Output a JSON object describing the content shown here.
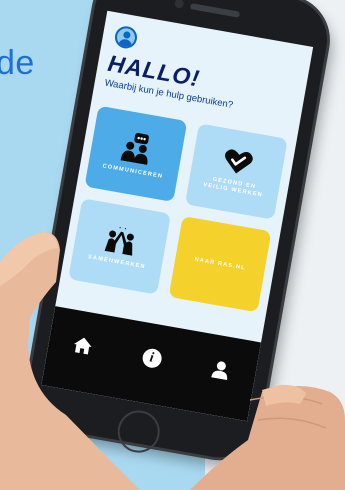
{
  "background": {
    "headline_fragment": "de"
  },
  "app": {
    "greeting": "HALLO!",
    "subtitle": "Waarbij kun je hulp gebruiken?",
    "tiles": [
      {
        "label": "COMMUNICEREN",
        "icon": "chat-people-icon",
        "color": "#4dabe8"
      },
      {
        "label": "GEZOND EN VEILIG WERKEN",
        "icon": "heart-check-icon",
        "color": "#aedbf6"
      },
      {
        "label": "SAMENWERKEN",
        "icon": "high-five-icon",
        "color": "#aedbf6"
      },
      {
        "label": "NAAR RAS.NL",
        "icon": "",
        "color": "#f5d12c"
      }
    ],
    "tabbar": [
      {
        "icon": "home-icon",
        "active": true
      },
      {
        "icon": "info-icon",
        "glyph": "i"
      },
      {
        "icon": "profile-icon"
      }
    ]
  },
  "colors": {
    "primary_dark": "#0a1f66",
    "accent_blue": "#4dabe8",
    "light_blue": "#aedbf6",
    "yellow": "#f5d12c"
  }
}
